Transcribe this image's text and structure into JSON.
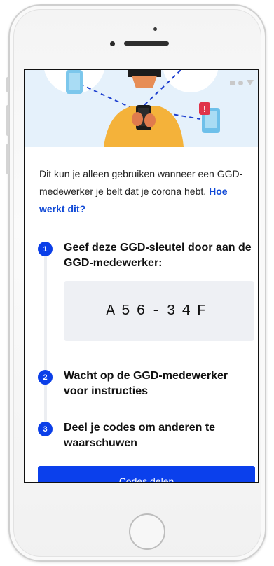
{
  "intro": {
    "text": "Dit kun je alleen gebruiken wanneer een GGD-medewerker je belt dat je corona hebt.",
    "link": "Hoe werkt dit?"
  },
  "steps": [
    {
      "number": "1",
      "title": "Geef deze GGD-sleutel door aan de GGD-medewerker:"
    },
    {
      "number": "2",
      "title": "Wacht op de GGD-medewerker voor instructies"
    },
    {
      "number": "3",
      "title": "Deel je codes om anderen te waarschuwen"
    }
  ],
  "ggd_key": "A56-34F",
  "button": {
    "label": "Codes delen"
  },
  "icons": {
    "alert_badge": "!"
  },
  "colors": {
    "accent": "#0b40ec",
    "hero_bg": "#e5f1fb",
    "code_bg": "#eef0f4"
  }
}
